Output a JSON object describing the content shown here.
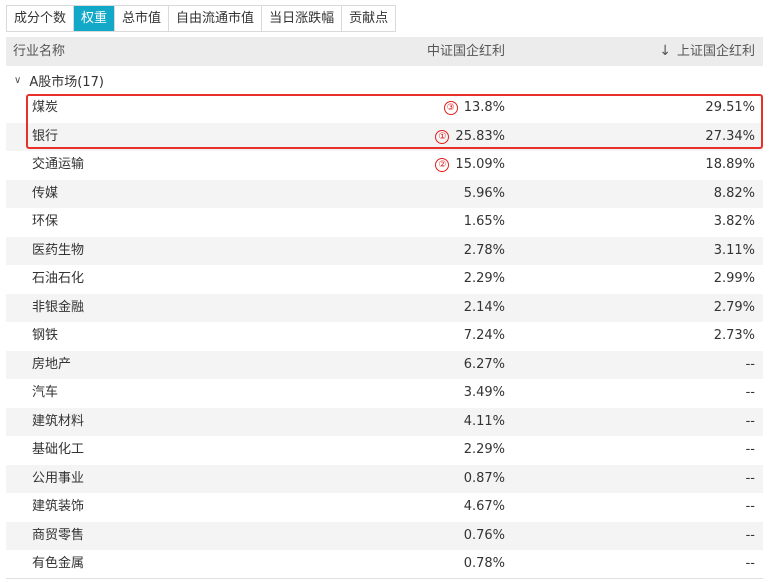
{
  "tabs": [
    "成分个数",
    "权重",
    "总市值",
    "自由流通市值",
    "当日涨跌幅",
    "贡献点"
  ],
  "active_tab": 1,
  "header": {
    "col1": "行业名称",
    "col2": "中证国企红利",
    "col3": "上证国企红利",
    "sort_icon": "arrow-down-icon"
  },
  "group": {
    "label": "A股市场(17)",
    "expand_icon": "chevron-down-icon"
  },
  "markers": [
    "①",
    "②",
    "③"
  ],
  "highlight_color": "#e8302a",
  "accent_color": "#12a8c8",
  "rows": [
    {
      "name": "煤炭",
      "v1": "13.8%",
      "v2": "29.51%",
      "marker": "③"
    },
    {
      "name": "银行",
      "v1": "25.83%",
      "v2": "27.34%",
      "marker": "①"
    },
    {
      "name": "交通运输",
      "v1": "15.09%",
      "v2": "18.89%",
      "marker": "②"
    },
    {
      "name": "传媒",
      "v1": "5.96%",
      "v2": "8.82%"
    },
    {
      "name": "环保",
      "v1": "1.65%",
      "v2": "3.82%"
    },
    {
      "name": "医药生物",
      "v1": "2.78%",
      "v2": "3.11%"
    },
    {
      "name": "石油石化",
      "v1": "2.29%",
      "v2": "2.99%"
    },
    {
      "name": "非银金融",
      "v1": "2.14%",
      "v2": "2.79%"
    },
    {
      "name": "钢铁",
      "v1": "7.24%",
      "v2": "2.73%"
    },
    {
      "name": "房地产",
      "v1": "6.27%",
      "v2": "--"
    },
    {
      "name": "汽车",
      "v1": "3.49%",
      "v2": "--"
    },
    {
      "name": "建筑材料",
      "v1": "4.11%",
      "v2": "--"
    },
    {
      "name": "基础化工",
      "v1": "2.29%",
      "v2": "--"
    },
    {
      "name": "公用事业",
      "v1": "0.87%",
      "v2": "--"
    },
    {
      "name": "建筑装饰",
      "v1": "4.67%",
      "v2": "--"
    },
    {
      "name": "商贸零售",
      "v1": "0.76%",
      "v2": "--"
    },
    {
      "name": "有色金属",
      "v1": "0.78%",
      "v2": "--"
    }
  ]
}
